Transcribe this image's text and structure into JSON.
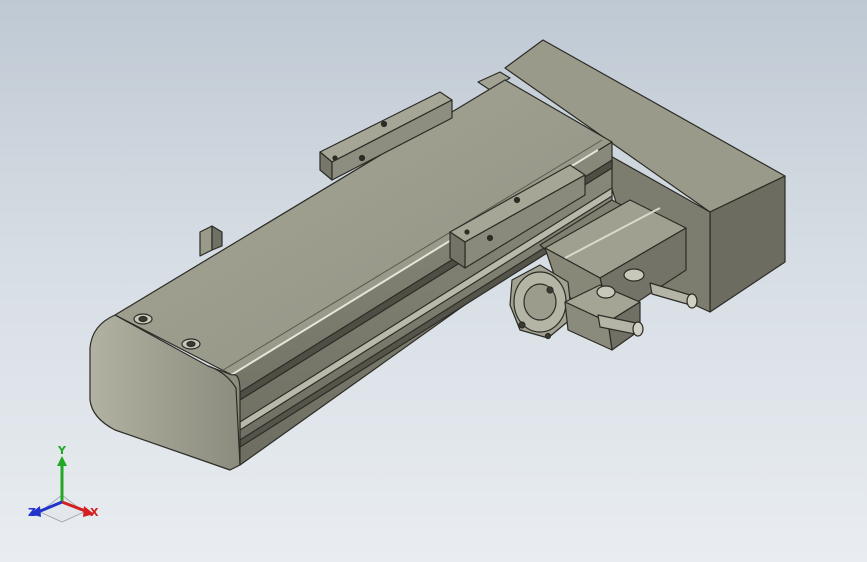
{
  "viewport": {
    "background_top": "#bfc9d3",
    "background_bottom": "#e9edf1"
  },
  "model": {
    "body_color": "#8e8e7e",
    "body_dark": "#5f5f53",
    "body_light": "#b4b4a6",
    "rail_color": "#a7a79a",
    "edge_color": "#2c2c26"
  },
  "triad": {
    "x_label": "X",
    "y_label": "Y",
    "z_label": "Z",
    "x_color": "#d42020",
    "y_color": "#22a822",
    "z_color": "#2233cc"
  }
}
